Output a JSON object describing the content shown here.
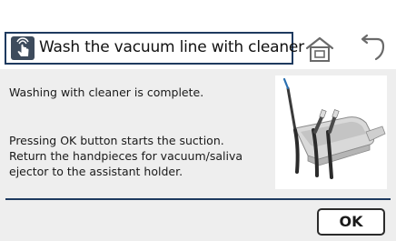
{
  "header": {
    "title": "Wash the vacuum line with cleaner",
    "title_icon": "hand-tap-icon",
    "home_icon": "home-icon",
    "back_icon": "back-arrow-icon"
  },
  "content": {
    "status_message": "Washing with cleaner is complete.",
    "instruction_lines": [
      "Pressing OK button starts the suction.",
      "Return the handpieces for vacuum/saliva",
      "ejector to the assistant holder."
    ],
    "illustration_icon": "assistant-holder-handpieces-image"
  },
  "footer": {
    "ok_label": "OK"
  },
  "colors": {
    "frame_border": "#1e3a5f",
    "content_background": "#eeeeee",
    "icon_dark": "#3d4b5c"
  }
}
